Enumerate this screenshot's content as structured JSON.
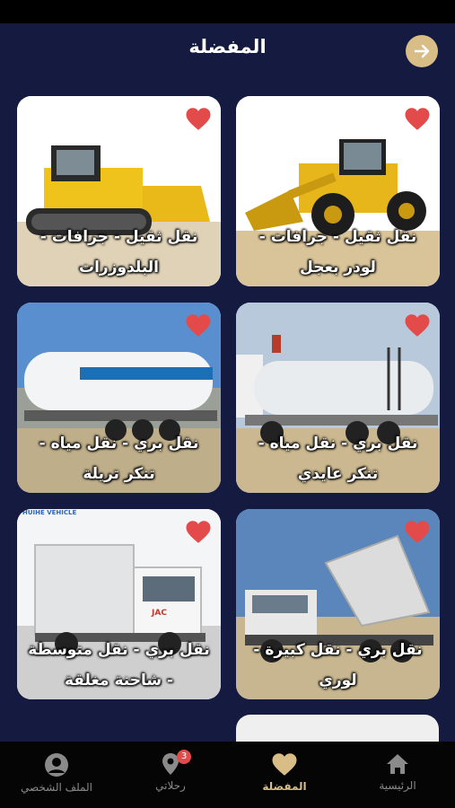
{
  "header": {
    "title": "المفضلة"
  },
  "cards": [
    {
      "label": "نقل ثقيل - جرافات - لودر بعجل",
      "image": "wheel-loader"
    },
    {
      "label": "نقل ثقيل - جرافات - البلدوزرات",
      "image": "bulldozer"
    },
    {
      "label": "نقل بري - نقل مياه - تنكر عايدي",
      "image": "water-tanker-truck"
    },
    {
      "label": "نقل بري - نقل مياه - تنكر تريلة",
      "image": "water-tanker-trailer"
    },
    {
      "label": "نقل بري - نقل كبيرة - لوري",
      "image": "dump-truck"
    },
    {
      "label": "نقل بري - نقل متوسطة - شاحنة مغلقة",
      "image": "box-truck",
      "brand_text": "HUIHE VEHICLE",
      "truck_text": "JAC"
    }
  ],
  "nav": {
    "home": "الرئيسية",
    "favorites": "المفضلة",
    "trips": "رحلاتي",
    "trips_badge": "3",
    "profile": "الملف الشخصي"
  },
  "colors": {
    "background": "#141a40",
    "accent": "#d8bd86",
    "heart": "#e34b4b"
  }
}
